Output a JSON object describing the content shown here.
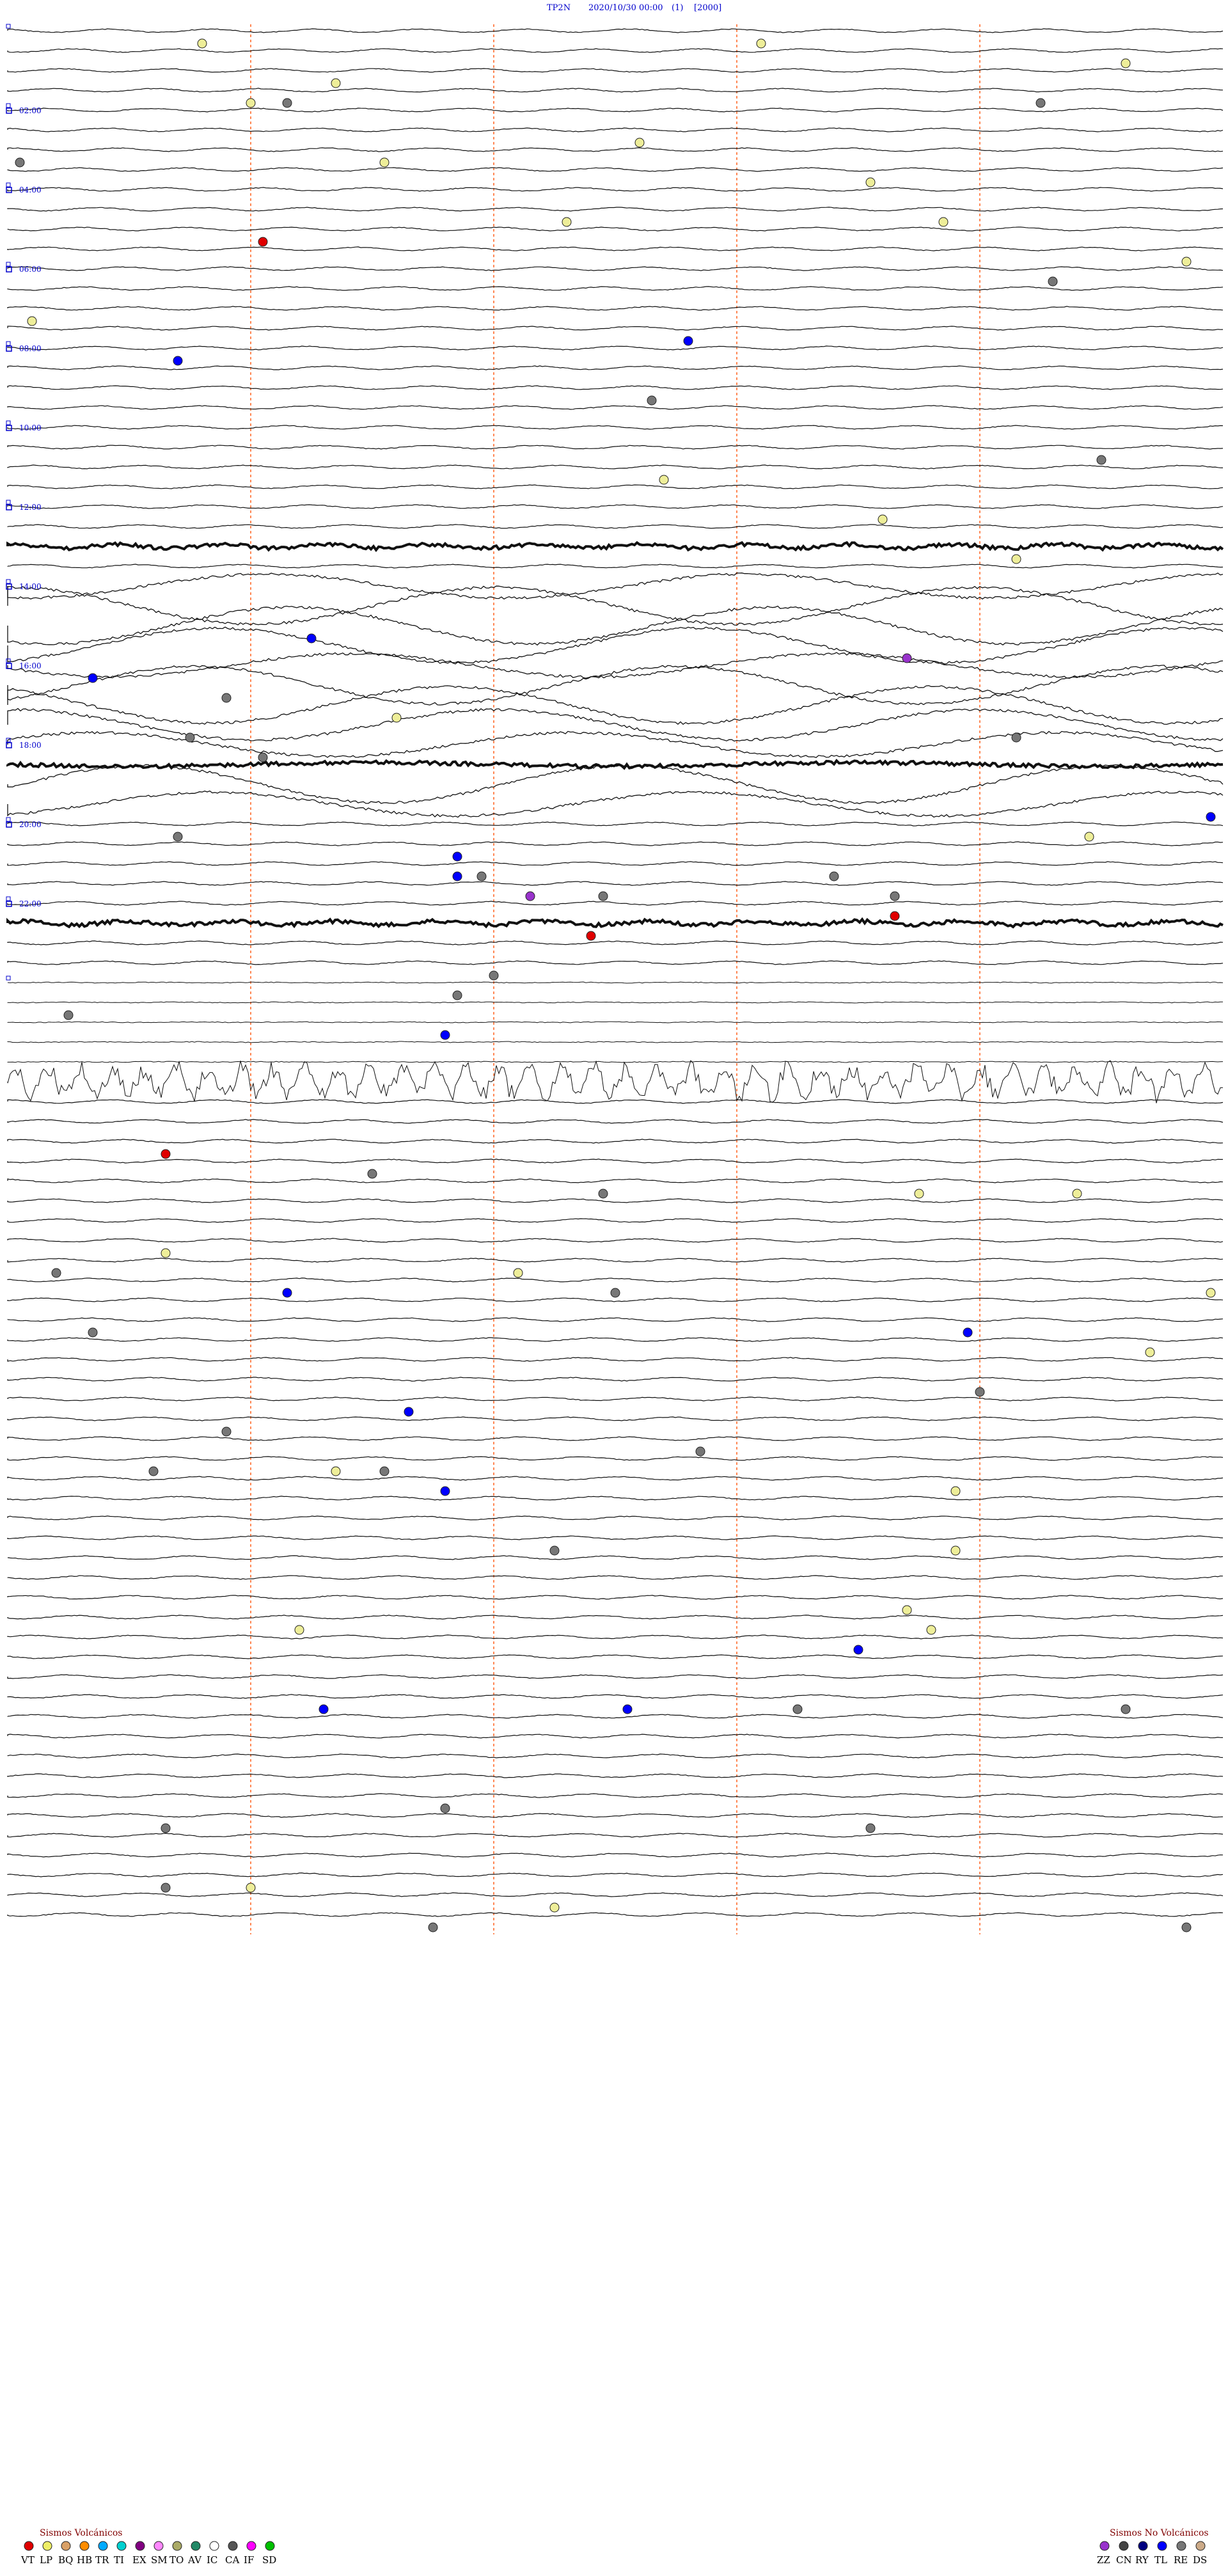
{
  "chart_data": {
    "type": "seismogram",
    "station": "TP2N",
    "datetime": "2020/10/30 00:00",
    "channel": "(1)",
    "scale": "[2000]",
    "hours": [
      "02:00",
      "04:00",
      "06:00",
      "08:00",
      "10:00",
      "12:00",
      "14:00",
      "16:00",
      "18:00",
      "20:00",
      "22:00"
    ],
    "lines_per_hour": 4,
    "events": [
      {
        "line": 0,
        "x": 0.16,
        "type": "LP"
      },
      {
        "line": 0,
        "x": 0.62,
        "type": "LP"
      },
      {
        "line": 1,
        "x": 0.92,
        "type": "LP"
      },
      {
        "line": 2,
        "x": 0.27,
        "type": "LP"
      },
      {
        "line": 3,
        "x": 0.2,
        "type": "LP"
      },
      {
        "line": 3,
        "x": 0.23,
        "type": "RE"
      },
      {
        "line": 3,
        "x": 0.85,
        "type": "RE"
      },
      {
        "line": 5,
        "x": 0.52,
        "type": "LP"
      },
      {
        "line": 6,
        "x": 0.01,
        "type": "RE"
      },
      {
        "line": 6,
        "x": 0.31,
        "type": "LP"
      },
      {
        "line": 7,
        "x": 0.71,
        "type": "LP"
      },
      {
        "line": 9,
        "x": 0.46,
        "type": "LP"
      },
      {
        "line": 9,
        "x": 0.77,
        "type": "LP"
      },
      {
        "line": 10,
        "x": 0.21,
        "type": "VT"
      },
      {
        "line": 11,
        "x": 0.97,
        "type": "LP"
      },
      {
        "line": 12,
        "x": 0.86,
        "type": "RE"
      },
      {
        "line": 14,
        "x": 0.02,
        "type": "LP"
      },
      {
        "line": 15,
        "x": 0.56,
        "type": "TL"
      },
      {
        "line": 16,
        "x": 0.14,
        "type": "TL"
      },
      {
        "line": 18,
        "x": 0.53,
        "type": "RE"
      },
      {
        "line": 21,
        "x": 0.9,
        "type": "RE"
      },
      {
        "line": 22,
        "x": 0.54,
        "type": "LP"
      },
      {
        "line": 24,
        "x": 0.72,
        "type": "LP"
      },
      {
        "line": 26,
        "x": 0.83,
        "type": "LP"
      },
      {
        "line": 30,
        "x": 0.25,
        "type": "TL"
      },
      {
        "line": 31,
        "x": 0.74,
        "type": "EX"
      },
      {
        "line": 32,
        "x": 0.07,
        "type": "TL"
      },
      {
        "line": 33,
        "x": 0.18,
        "type": "RE"
      },
      {
        "line": 34,
        "x": 0.32,
        "type": "LP"
      },
      {
        "line": 35,
        "x": 0.15,
        "type": "RE"
      },
      {
        "line": 35,
        "x": 0.83,
        "type": "RE"
      },
      {
        "line": 36,
        "x": 0.21,
        "type": "RE"
      },
      {
        "line": 39,
        "x": 0.99,
        "type": "TL"
      },
      {
        "line": 40,
        "x": 0.89,
        "type": "LP"
      },
      {
        "line": 40,
        "x": 0.14,
        "type": "RE"
      },
      {
        "line": 41,
        "x": 0.37,
        "type": "TL"
      },
      {
        "line": 42,
        "x": 0.37,
        "type": "TL"
      },
      {
        "line": 42,
        "x": 0.39,
        "type": "RE"
      },
      {
        "line": 42,
        "x": 0.68,
        "type": "RE"
      },
      {
        "line": 43,
        "x": 0.73,
        "type": "RE"
      },
      {
        "line": 43,
        "x": 0.43,
        "type": "EX"
      },
      {
        "line": 43,
        "x": 0.49,
        "type": "RE"
      },
      {
        "line": 44,
        "x": 0.73,
        "type": "VT"
      },
      {
        "line": 45,
        "x": 0.48,
        "type": "VT"
      },
      {
        "line": 47,
        "x": 0.4,
        "type": "RE"
      },
      {
        "line": 48,
        "x": 0.37,
        "type": "RE"
      },
      {
        "line": 49,
        "x": 0.05,
        "type": "RE"
      },
      {
        "line": 50,
        "x": 0.36,
        "type": "TL"
      },
      {
        "line": 56,
        "x": 0.13,
        "type": "VT"
      },
      {
        "line": 57,
        "x": 0.3,
        "type": "RE"
      },
      {
        "line": 58,
        "x": 0.49,
        "type": "RE"
      },
      {
        "line": 58,
        "x": 0.88,
        "type": "LP"
      },
      {
        "line": 58,
        "x": 0.75,
        "type": "LP"
      },
      {
        "line": 61,
        "x": 0.13,
        "type": "LP"
      },
      {
        "line": 62,
        "x": 0.04,
        "type": "RE"
      },
      {
        "line": 62,
        "x": 0.42,
        "type": "LP"
      },
      {
        "line": 63,
        "x": 0.23,
        "type": "TL"
      },
      {
        "line": 63,
        "x": 0.5,
        "type": "RE"
      },
      {
        "line": 63,
        "x": 0.99,
        "type": "LP"
      },
      {
        "line": 65,
        "x": 0.07,
        "type": "RE"
      },
      {
        "line": 65,
        "x": 0.79,
        "type": "TL"
      },
      {
        "line": 66,
        "x": 0.94,
        "type": "LP"
      },
      {
        "line": 68,
        "x": 0.8,
        "type": "RE"
      },
      {
        "line": 69,
        "x": 0.33,
        "type": "TL"
      },
      {
        "line": 70,
        "x": 0.18,
        "type": "RE"
      },
      {
        "line": 71,
        "x": 0.57,
        "type": "RE"
      },
      {
        "line": 72,
        "x": 0.12,
        "type": "RE"
      },
      {
        "line": 72,
        "x": 0.31,
        "type": "RE"
      },
      {
        "line": 72,
        "x": 0.27,
        "type": "LP"
      },
      {
        "line": 73,
        "x": 0.78,
        "type": "LP"
      },
      {
        "line": 73,
        "x": 0.36,
        "type": "TL"
      },
      {
        "line": 76,
        "x": 0.45,
        "type": "RE"
      },
      {
        "line": 76,
        "x": 0.78,
        "type": "LP"
      },
      {
        "line": 79,
        "x": 0.74,
        "type": "LP"
      },
      {
        "line": 80,
        "x": 0.24,
        "type": "LP"
      },
      {
        "line": 80,
        "x": 0.76,
        "type": "LP"
      },
      {
        "line": 81,
        "x": 0.7,
        "type": "TL"
      },
      {
        "line": 84,
        "x": 0.26,
        "type": "TL"
      },
      {
        "line": 84,
        "x": 0.51,
        "type": "TL"
      },
      {
        "line": 84,
        "x": 0.65,
        "type": "RE"
      },
      {
        "line": 84,
        "x": 0.92,
        "type": "RE"
      },
      {
        "line": 89,
        "x": 0.36,
        "type": "RE"
      },
      {
        "line": 90,
        "x": 0.13,
        "type": "RE"
      },
      {
        "line": 90,
        "x": 0.71,
        "type": "RE"
      },
      {
        "line": 93,
        "x": 0.2,
        "type": "LP"
      },
      {
        "line": 93,
        "x": 0.13,
        "type": "RE"
      },
      {
        "line": 94,
        "x": 0.45,
        "type": "LP"
      },
      {
        "line": 95,
        "x": 0.35,
        "type": "RE"
      },
      {
        "line": 95,
        "x": 0.97,
        "type": "RE"
      }
    ],
    "legend_volcanic": {
      "title": "Sismos Volcánicos",
      "codes": [
        "VT",
        "LP",
        "BQ",
        "HB",
        "TR",
        "TI",
        "EX",
        "SM",
        "TO",
        "AV",
        "IC",
        "CA",
        "IF",
        "SD"
      ],
      "colors": [
        "#e00000",
        "#eeee66",
        "#d9a066",
        "#ff8c00",
        "#00aaff",
        "#00d0d0",
        "#800080",
        "#ff88ff",
        "#aaaa66",
        "#228866",
        "#ffffff",
        "#555555",
        "#ff00ff",
        "#00c000"
      ]
    },
    "legend_nonvolcanic": {
      "title": "Sismos No Volcánicos",
      "codes": [
        "ZZ",
        "CN",
        "RY",
        "TL",
        "RE",
        "DS"
      ],
      "colors": [
        "#9933cc",
        "#444444",
        "#000080",
        "#0000ff",
        "#777777",
        "#ccaa88"
      ]
    },
    "event_colors": {
      "VT": "#e00000",
      "LP": "#eeee99",
      "EX": "#9933cc",
      "TL": "#0000ff",
      "RE": "#777777"
    }
  }
}
